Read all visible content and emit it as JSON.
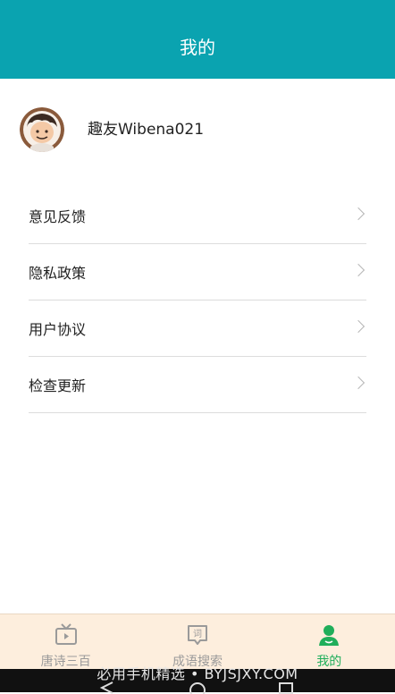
{
  "header": {
    "title": "我的"
  },
  "profile": {
    "username": "趣友Wibena021"
  },
  "menu": {
    "items": [
      {
        "label": "意见反馈"
      },
      {
        "label": "隐私政策"
      },
      {
        "label": "用户协议"
      },
      {
        "label": "检查更新"
      }
    ]
  },
  "tabbar": {
    "tabs": [
      {
        "label": "唐诗三百",
        "icon": "tv-icon",
        "active": false
      },
      {
        "label": "成语搜索",
        "icon": "chat-word-icon",
        "active": false
      },
      {
        "label": "我的",
        "icon": "user-icon",
        "active": true
      }
    ]
  },
  "overlay": {
    "watermark": "必用手机精选 • BYJSJXY.COM"
  },
  "colors": {
    "header": "#0aa3b0",
    "active_tab": "#1fae5a",
    "tabbar_bg": "#fdeedd"
  }
}
